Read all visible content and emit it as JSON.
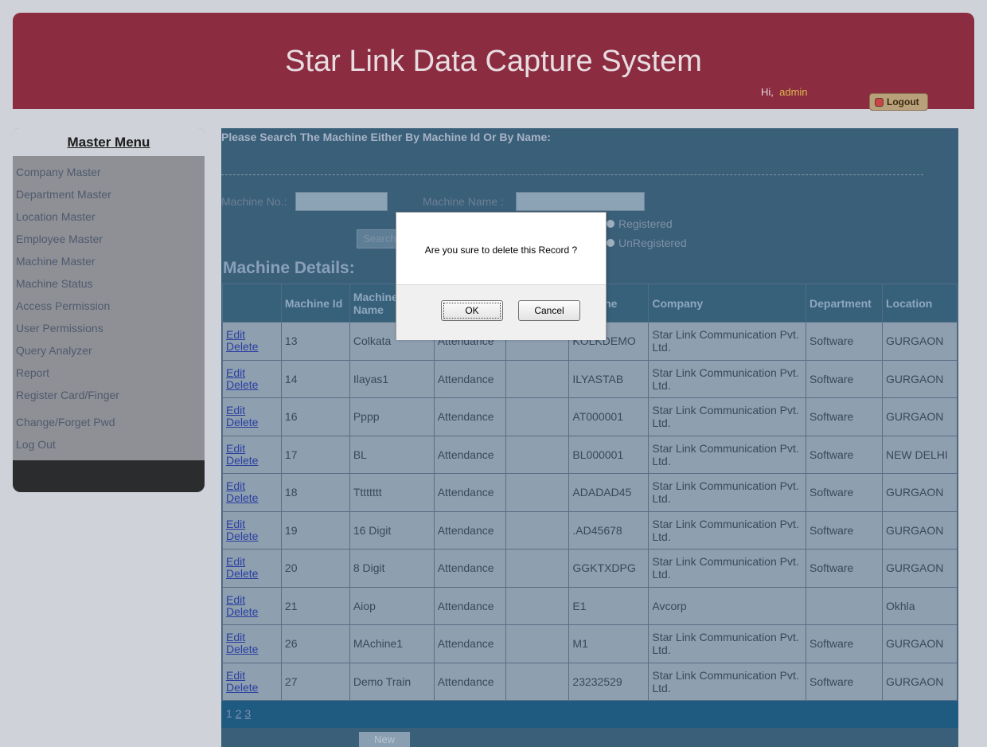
{
  "header": {
    "title": "Star Link Data Capture System",
    "greeting": "Hi,",
    "user": "admin",
    "logout_label": "Logout"
  },
  "sidebar": {
    "title": "Master Menu",
    "items": [
      {
        "label": "Company Master"
      },
      {
        "label": "Department Master"
      },
      {
        "label": "Location Master"
      },
      {
        "label": "Employee Master"
      },
      {
        "label": "Machine Master"
      },
      {
        "label": "Machine Status"
      },
      {
        "label": "Access Permission"
      },
      {
        "label": "User Permissions"
      },
      {
        "label": "Query Analyzer"
      },
      {
        "label": "Report"
      },
      {
        "label": "Register Card/Finger"
      },
      {
        "label": "Change/Forget Pwd"
      },
      {
        "label": "Log Out"
      }
    ]
  },
  "search": {
    "title": "Please Search The Machine Either By Machine Id Or By Name:",
    "machine_no_label": "Machine No.:",
    "machine_name_label": "Machine Name :",
    "radio_registered": "Registered",
    "radio_unregistered": "UnRegistered",
    "search_button": "Search"
  },
  "machine_details": {
    "heading": "Machine Details:",
    "columns": [
      "",
      "Machine Id",
      "Machine Name",
      "",
      "",
      "Machine",
      "Company",
      "Department",
      "Location"
    ],
    "edit_label": "Edit",
    "delete_label": "Delete",
    "rows": [
      {
        "id": "13",
        "name": "Colkata",
        "type": "Attendance",
        "blank": "",
        "code": "KOLKDEMO",
        "company": "Star Link Communication Pvt. Ltd.",
        "department": "Software",
        "location": "GURGAON"
      },
      {
        "id": "14",
        "name": "Ilayas1",
        "type": "Attendance",
        "blank": "",
        "code": "ILYASTAB",
        "company": "Star Link Communication Pvt. Ltd.",
        "department": "Software",
        "location": "GURGAON"
      },
      {
        "id": "16",
        "name": "Pppp",
        "type": "Attendance",
        "blank": "",
        "code": "AT000001",
        "company": "Star Link Communication Pvt. Ltd.",
        "department": "Software",
        "location": "GURGAON"
      },
      {
        "id": "17",
        "name": "BL",
        "type": "Attendance",
        "blank": "",
        "code": "BL000001",
        "company": "Star Link Communication Pvt. Ltd.",
        "department": "Software",
        "location": "NEW DELHI"
      },
      {
        "id": "18",
        "name": "Tttttttt",
        "type": "Attendance",
        "blank": "",
        "code": "ADADAD45",
        "company": "Star Link Communication Pvt. Ltd.",
        "department": "Software",
        "location": "GURGAON"
      },
      {
        "id": "19",
        "name": "16 Digit",
        "type": "Attendance",
        "blank": "",
        "code": ".AD45678",
        "company": "Star Link Communication Pvt. Ltd.",
        "department": "Software",
        "location": "GURGAON"
      },
      {
        "id": "20",
        "name": "8 Digit",
        "type": "Attendance",
        "blank": "",
        "code": "GGKTXDPG",
        "company": "Star Link Communication Pvt. Ltd.",
        "department": "Software",
        "location": "GURGAON"
      },
      {
        "id": "21",
        "name": "Aiop",
        "type": "Attendance",
        "blank": "",
        "code": "E1",
        "company": "Avcorp",
        "department": "",
        "location": "Okhla"
      },
      {
        "id": "26",
        "name": "MAchine1",
        "type": "Attendance",
        "blank": "",
        "code": "M1",
        "company": "Star Link Communication Pvt. Ltd.",
        "department": "Software",
        "location": "GURGAON"
      },
      {
        "id": "27",
        "name": "Demo Train",
        "type": "Attendance",
        "blank": "",
        "code": "23232529",
        "company": "Star Link Communication Pvt. Ltd.",
        "department": "Software",
        "location": "GURGAON"
      }
    ],
    "pages": [
      "1",
      "2",
      "3"
    ],
    "new_button": "New"
  },
  "dialog": {
    "message": "Are you sure to delete this Record ?",
    "ok_label": "OK",
    "cancel_label": "Cancel"
  },
  "colors": {
    "header_bg": "#8b2c40",
    "panel_bg": "#3a5f78",
    "sidebar_bg": "#8e9095",
    "logout_user": "#e0b64e"
  }
}
